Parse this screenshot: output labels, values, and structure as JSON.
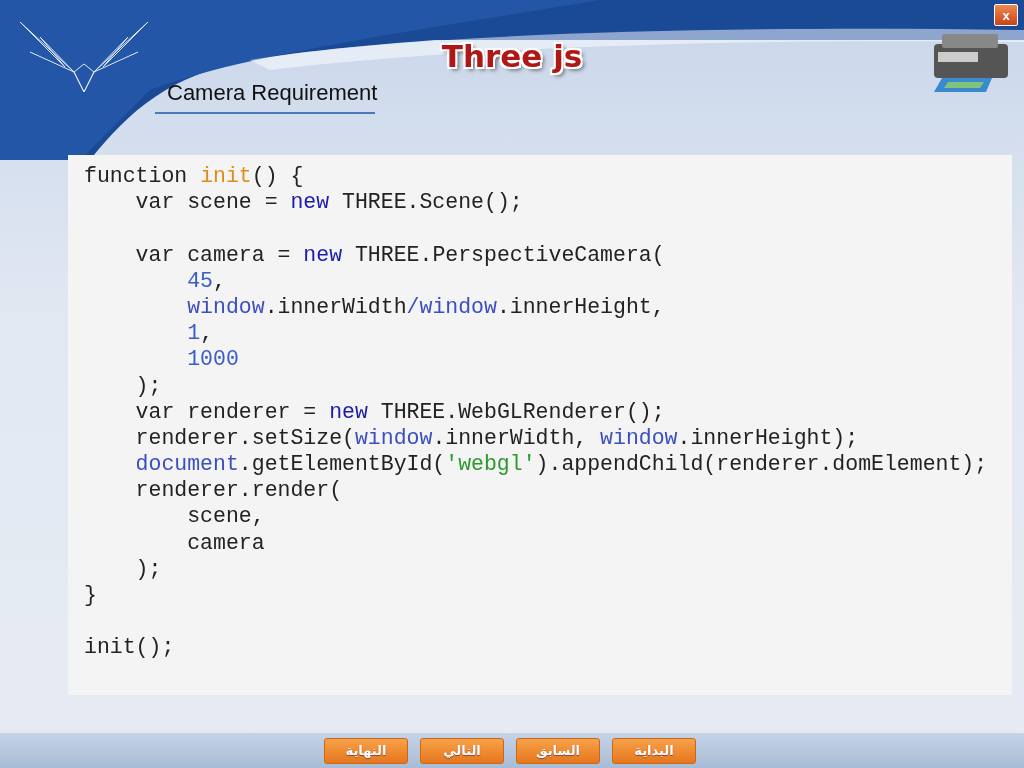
{
  "title": "Three js",
  "subtitle": "Camera Requirement",
  "code": [
    {
      "tokens": [
        {
          "text": "function ",
          "kind": "plain"
        },
        {
          "text": "init",
          "kind": "fn"
        },
        {
          "text": "() {",
          "kind": "plain"
        }
      ]
    },
    {
      "tokens": [
        {
          "text": "    var scene = ",
          "kind": "plain"
        },
        {
          "text": "new",
          "kind": "kw"
        },
        {
          "text": " THREE.Scene();",
          "kind": "plain"
        }
      ]
    },
    {
      "gap_before": true,
      "tokens": [
        {
          "text": "    var camera = ",
          "kind": "plain"
        },
        {
          "text": "new",
          "kind": "kw"
        },
        {
          "text": " THREE.PerspectiveCamera(",
          "kind": "plain"
        }
      ]
    },
    {
      "tokens": [
        {
          "text": "        45",
          "kind": "num"
        },
        {
          "text": ",",
          "kind": "plain"
        }
      ]
    },
    {
      "tokens": [
        {
          "text": "        window",
          "kind": "glob"
        },
        {
          "text": ".innerWidth",
          "kind": "plain"
        },
        {
          "text": "/window",
          "kind": "glob"
        },
        {
          "text": ".innerHeight,",
          "kind": "plain"
        }
      ]
    },
    {
      "tokens": [
        {
          "text": "        1",
          "kind": "num"
        },
        {
          "text": ",",
          "kind": "plain"
        }
      ]
    },
    {
      "tokens": [
        {
          "text": "        1000",
          "kind": "num"
        }
      ]
    },
    {
      "tokens": [
        {
          "text": "    );",
          "kind": "plain"
        }
      ]
    },
    {
      "tokens": [
        {
          "text": "    var renderer = ",
          "kind": "plain"
        },
        {
          "text": "new",
          "kind": "kw"
        },
        {
          "text": " THREE.WebGLRenderer();",
          "kind": "plain"
        }
      ]
    },
    {
      "tokens": [
        {
          "text": "    renderer.setSize(",
          "kind": "plain"
        },
        {
          "text": "window",
          "kind": "glob"
        },
        {
          "text": ".innerWidth, ",
          "kind": "plain"
        },
        {
          "text": "window",
          "kind": "glob"
        },
        {
          "text": ".innerHeight);",
          "kind": "plain"
        }
      ]
    },
    {
      "tokens": [
        {
          "text": "    document",
          "kind": "glob"
        },
        {
          "text": ".getElementById(",
          "kind": "plain"
        },
        {
          "text": "'webgl'",
          "kind": "str"
        },
        {
          "text": ").appendChild(renderer.domElement);",
          "kind": "plain"
        }
      ]
    },
    {
      "tokens": [
        {
          "text": "    renderer.render(",
          "kind": "plain"
        }
      ]
    },
    {
      "tokens": [
        {
          "text": "        scene,",
          "kind": "plain"
        }
      ]
    },
    {
      "tokens": [
        {
          "text": "        camera",
          "kind": "plain"
        }
      ]
    },
    {
      "tokens": [
        {
          "text": "    );",
          "kind": "plain"
        }
      ]
    },
    {
      "tokens": [
        {
          "text": "}",
          "kind": "plain"
        }
      ]
    },
    {
      "gap_before": true,
      "tokens": [
        {
          "text": "init();",
          "kind": "plain"
        }
      ]
    }
  ],
  "close_button": "x",
  "nav_buttons": [
    "البداية",
    "السابق",
    "التالي",
    "النهاية"
  ]
}
